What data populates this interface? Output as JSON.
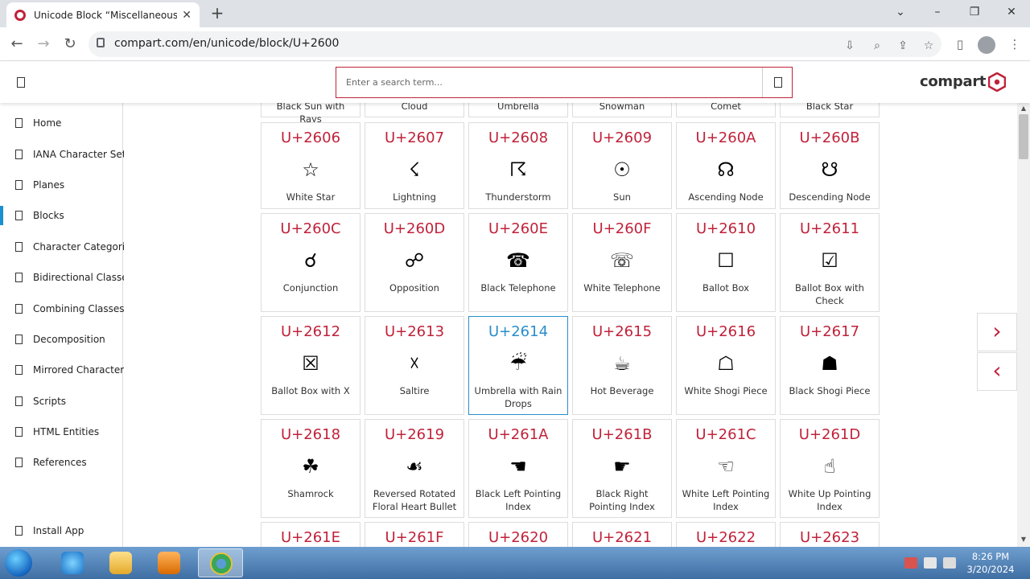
{
  "browser": {
    "tab_title": "Unicode Block “Miscellaneous S",
    "url": "compart.com/en/unicode/block/U+2600"
  },
  "site": {
    "search_placeholder": "Enter a search term...",
    "logo_text": "compart",
    "brand_color": "#c0223a"
  },
  "sidebar": {
    "items": [
      {
        "label": "Home"
      },
      {
        "label": "IANA Character Sets"
      },
      {
        "label": "Planes"
      },
      {
        "label": "Blocks"
      },
      {
        "label": "Character Categories"
      },
      {
        "label": "Bidirectional Classes"
      },
      {
        "label": "Combining Classes"
      },
      {
        "label": "Decomposition"
      },
      {
        "label": "Mirrored Characters"
      },
      {
        "label": "Scripts"
      },
      {
        "label": "HTML Entities"
      },
      {
        "label": "References"
      }
    ],
    "install": "Install App",
    "active_label": "Blocks"
  },
  "grid": {
    "top_partial": [
      "Black Sun with Rays",
      "Cloud",
      "Umbrella",
      "Snowman",
      "Comet",
      "Black Star"
    ],
    "rows": [
      [
        {
          "code": "U+2606",
          "glyph": "☆",
          "name": "White Star"
        },
        {
          "code": "U+2607",
          "glyph": "☇",
          "name": "Lightning"
        },
        {
          "code": "U+2608",
          "glyph": "☈",
          "name": "Thunderstorm"
        },
        {
          "code": "U+2609",
          "glyph": "☉",
          "name": "Sun"
        },
        {
          "code": "U+260A",
          "glyph": "☊",
          "name": "Ascending Node"
        },
        {
          "code": "U+260B",
          "glyph": "☋",
          "name": "Descending Node"
        }
      ],
      [
        {
          "code": "U+260C",
          "glyph": "☌",
          "name": "Conjunction"
        },
        {
          "code": "U+260D",
          "glyph": "☍",
          "name": "Opposition"
        },
        {
          "code": "U+260E",
          "glyph": "☎",
          "name": "Black Telephone"
        },
        {
          "code": "U+260F",
          "glyph": "☏",
          "name": "White Telephone"
        },
        {
          "code": "U+2610",
          "glyph": "☐",
          "name": "Ballot Box"
        },
        {
          "code": "U+2611",
          "glyph": "☑",
          "name": "Ballot Box with Check"
        }
      ],
      [
        {
          "code": "U+2612",
          "glyph": "☒",
          "name": "Ballot Box with X"
        },
        {
          "code": "U+2613",
          "glyph": "☓",
          "name": "Saltire"
        },
        {
          "code": "U+2614",
          "glyph": "☔",
          "name": "Umbrella with Rain Drops"
        },
        {
          "code": "U+2615",
          "glyph": "☕",
          "name": "Hot Beverage"
        },
        {
          "code": "U+2616",
          "glyph": "☖",
          "name": "White Shogi Piece"
        },
        {
          "code": "U+2617",
          "glyph": "☗",
          "name": "Black Shogi Piece"
        }
      ],
      [
        {
          "code": "U+2618",
          "glyph": "☘",
          "name": "Shamrock"
        },
        {
          "code": "U+2619",
          "glyph": "☙",
          "name": "Reversed Rotated Floral Heart Bullet"
        },
        {
          "code": "U+261A",
          "glyph": "☚",
          "name": "Black Left Pointing Index"
        },
        {
          "code": "U+261B",
          "glyph": "☛",
          "name": "Black Right Pointing Index"
        },
        {
          "code": "U+261C",
          "glyph": "☜",
          "name": "White Left Pointing Index"
        },
        {
          "code": "U+261D",
          "glyph": "☝",
          "name": "White Up Pointing Index"
        }
      ],
      [
        {
          "code": "U+261E",
          "glyph": "",
          "name": ""
        },
        {
          "code": "U+261F",
          "glyph": "",
          "name": ""
        },
        {
          "code": "U+2620",
          "glyph": "",
          "name": ""
        },
        {
          "code": "U+2621",
          "glyph": "",
          "name": ""
        },
        {
          "code": "U+2622",
          "glyph": "",
          "name": ""
        },
        {
          "code": "U+2623",
          "glyph": "",
          "name": ""
        }
      ]
    ],
    "hovered_code": "U+2614"
  },
  "pager": {
    "next_glyph": "›",
    "prev_glyph": "‹"
  },
  "taskbar": {
    "time": "8:26 PM",
    "date": "3/20/2024"
  }
}
